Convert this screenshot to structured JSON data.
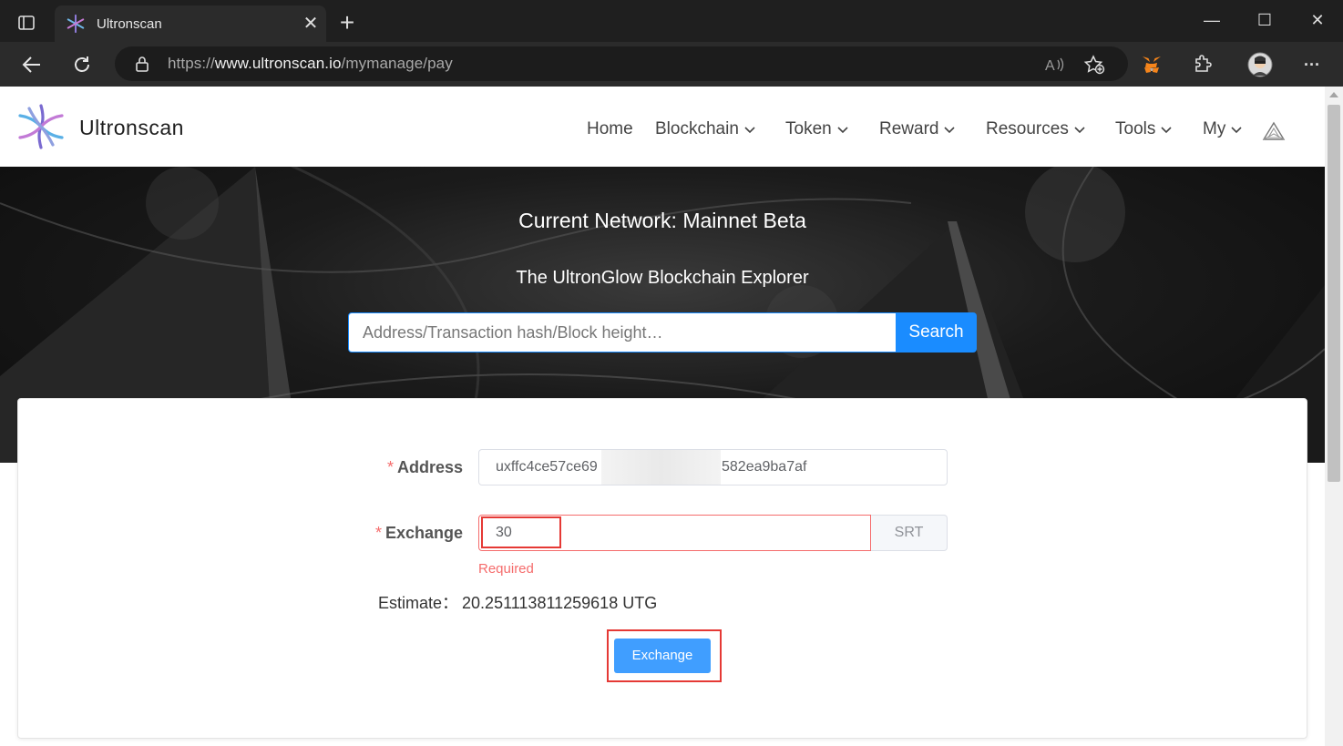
{
  "browser": {
    "tab_title": "Ultronscan",
    "tab_close": "✕",
    "new_tab": "+",
    "url_scheme": "https://",
    "url_host": "www.ultronscan.io",
    "url_path": "/mymanage/pay",
    "window_controls": {
      "minimize": "—",
      "maximize": "☐",
      "close": "✕"
    },
    "more_menu": "···"
  },
  "site": {
    "brand": "Ultronscan",
    "nav": [
      "Home",
      "Blockchain",
      "Token",
      "Reward",
      "Resources",
      "Tools",
      "My"
    ]
  },
  "hero": {
    "title": "Current Network: Mainnet Beta",
    "subtitle": "The UltronGlow Blockchain Explorer",
    "search_placeholder": "Address/Transaction hash/Block height…",
    "search_button": "Search"
  },
  "form": {
    "required_mark": "*",
    "address_label": "Address",
    "address_value_start": "uxffc4ce57ce69",
    "address_value_end": "582ea9ba7af",
    "exchange_label": "Exchange",
    "exchange_value": "30",
    "exchange_unit": "SRT",
    "error_message": "Required",
    "estimate_label": "Estimate：",
    "estimate_value": "20.251113811259618 UTG",
    "submit_button": "Exchange"
  },
  "colors": {
    "primary": "#1a8cff",
    "button": "#409eff",
    "error": "#f56c6c",
    "highlight": "#e53935"
  }
}
